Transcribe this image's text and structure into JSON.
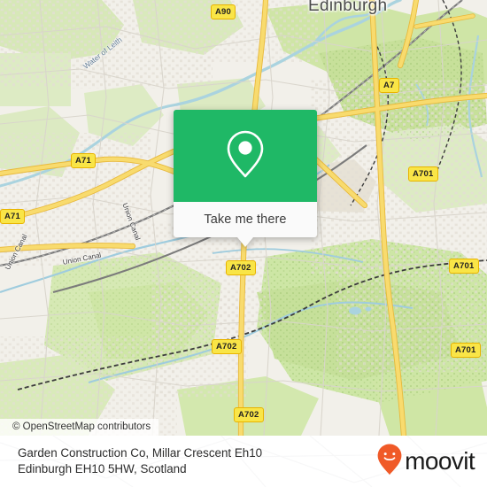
{
  "map": {
    "provider_attribution": "© OpenStreetMap contributors",
    "city_label": "Edinburgh",
    "water_labels": [
      {
        "name": "Water of Leith"
      }
    ],
    "canal_labels": [
      {
        "name": "Union Canal"
      },
      {
        "name": "Union Canal"
      },
      {
        "name": "Union Canal"
      }
    ],
    "road_shields": [
      {
        "ref": "A90"
      },
      {
        "ref": "A7"
      },
      {
        "ref": "A701"
      },
      {
        "ref": "A701"
      },
      {
        "ref": "A701"
      },
      {
        "ref": "A71"
      },
      {
        "ref": "A71"
      },
      {
        "ref": "A702"
      },
      {
        "ref": "A702"
      },
      {
        "ref": "A702"
      }
    ],
    "colors": {
      "land": "#F2EFE9",
      "park": "#CDE6A5",
      "wood": "#C5E0A5",
      "water": "#AAD3DF",
      "primary_road": "#F7D768",
      "rail": "#787878",
      "residential": "#FFFFFF"
    }
  },
  "callout": {
    "pin_icon": "map-pin-icon",
    "button_label": "Take me there",
    "accent_color": "#1FB866",
    "panel_color": "#FAFAFA"
  },
  "footer": {
    "address_line1": "Garden Construction Co, Millar Crescent Eh10",
    "address_line2": "Edinburgh EH10 5HW, Scotland",
    "brand_name": "moovit",
    "brand_icon": "moovit-pin-smiley-icon",
    "brand_color": "#F05A28"
  }
}
